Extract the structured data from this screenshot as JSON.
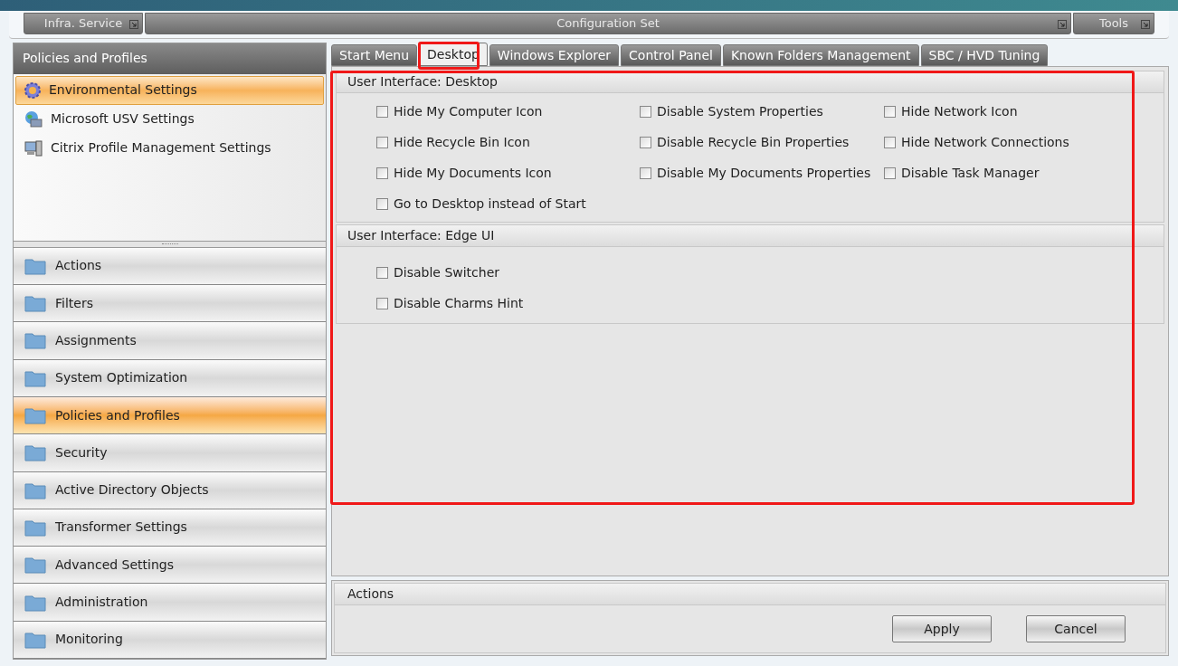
{
  "ribbon": [
    {
      "label": "Infra. Service"
    },
    {
      "label": "Configuration Set"
    },
    {
      "label": "Tools"
    }
  ],
  "sidebar": {
    "title": "Policies and Profiles",
    "items": [
      {
        "label": "Environmental Settings",
        "kind": "gear",
        "selected": true
      },
      {
        "label": "Microsoft USV Settings",
        "kind": "globe",
        "selected": false
      },
      {
        "label": "Citrix Profile Management Settings",
        "kind": "computer",
        "selected": false
      }
    ],
    "nav": [
      {
        "label": "Actions",
        "selected": false
      },
      {
        "label": "Filters",
        "selected": false
      },
      {
        "label": "Assignments",
        "selected": false
      },
      {
        "label": "System Optimization",
        "selected": false
      },
      {
        "label": "Policies and Profiles",
        "selected": true
      },
      {
        "label": "Security",
        "selected": false
      },
      {
        "label": "Active Directory Objects",
        "selected": false
      },
      {
        "label": "Transformer Settings",
        "selected": false
      },
      {
        "label": "Advanced Settings",
        "selected": false
      },
      {
        "label": "Administration",
        "selected": false
      },
      {
        "label": "Monitoring",
        "selected": false
      }
    ]
  },
  "tabs": [
    {
      "label": "Start Menu",
      "selected": false
    },
    {
      "label": "Desktop",
      "selected": true
    },
    {
      "label": "Windows Explorer",
      "selected": false
    },
    {
      "label": "Control Panel",
      "selected": false
    },
    {
      "label": "Known Folders Management",
      "selected": false
    },
    {
      "label": "SBC / HVD Tuning",
      "selected": false
    }
  ],
  "sections": [
    {
      "title": "User Interface: Desktop",
      "kind": "grid",
      "options": [
        {
          "label": "Hide My Computer Icon",
          "checked": false
        },
        {
          "label": "Disable System Properties",
          "checked": false
        },
        {
          "label": "Hide Network Icon",
          "checked": false
        },
        {
          "label": "Hide Recycle Bin Icon",
          "checked": false
        },
        {
          "label": "Disable Recycle Bin Properties",
          "checked": false
        },
        {
          "label": "Hide Network Connections",
          "checked": false
        },
        {
          "label": "Hide My Documents Icon",
          "checked": false
        },
        {
          "label": "Disable My Documents Properties",
          "checked": false
        },
        {
          "label": "Disable Task Manager",
          "checked": false
        },
        {
          "label": "Go to Desktop instead of Start",
          "checked": false
        }
      ]
    },
    {
      "title": "User Interface: Edge UI",
      "kind": "list",
      "options": [
        {
          "label": "Disable Switcher",
          "checked": false
        },
        {
          "label": "Disable Charms Hint",
          "checked": false
        }
      ]
    }
  ],
  "actions": {
    "title": "Actions",
    "buttons": [
      "Apply",
      "Cancel"
    ]
  }
}
